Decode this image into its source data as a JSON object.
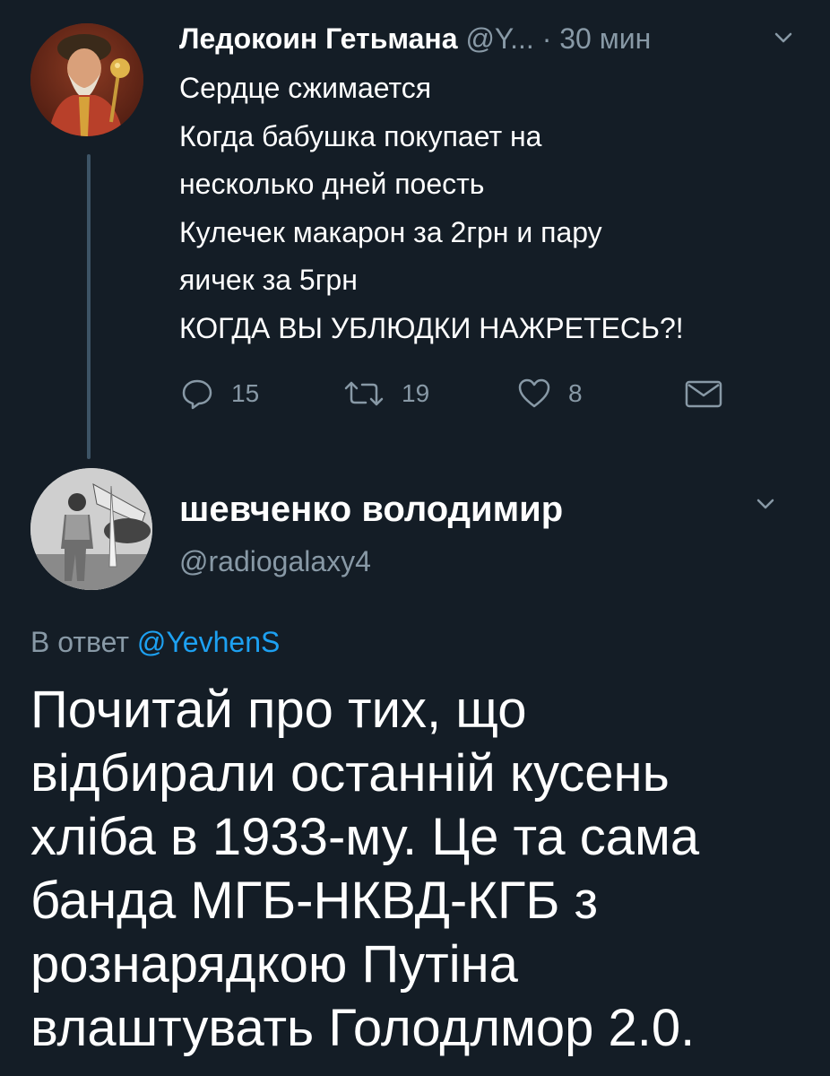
{
  "tweet1": {
    "avatar_icon": "portrait-hetman-avatar",
    "name": "Ледокоин Гетьмана",
    "handle": "@Y...",
    "time": "· 30 мин",
    "body_lines": [
      "Сердце сжимается",
      "Когда бабушка покупает на",
      "несколько дней поесть",
      "Кулечек макарон за 2грн и пару",
      "яичек за 5грн",
      "КОГДА ВЫ УБЛЮДКИ НАЖРЕТЕСЬ?!"
    ],
    "actions": {
      "reply_count": "15",
      "retweet_count": "19",
      "like_count": "8"
    }
  },
  "tweet2": {
    "avatar_icon": "photo-man-with-aircraft-avatar",
    "name": "шевченко володимир",
    "handle": "@radiogalaxy4",
    "reply_prefix": "В ответ",
    "reply_mention": "@YevhenS",
    "body_lines": [
      "Почитай про тих, що",
      "відбирали останній кусень",
      "хліба в 1933-му. Це та сама",
      "банда МГБ-НКВД-КГБ з",
      "рознарядкою Путіна",
      "влаштувать Голодлмор 2.0."
    ]
  },
  "colors": {
    "background": "#141d26",
    "text_primary": "#ffffff",
    "text_secondary": "#8899a6",
    "accent": "#1da1f2",
    "thread_line": "#3d5466"
  }
}
